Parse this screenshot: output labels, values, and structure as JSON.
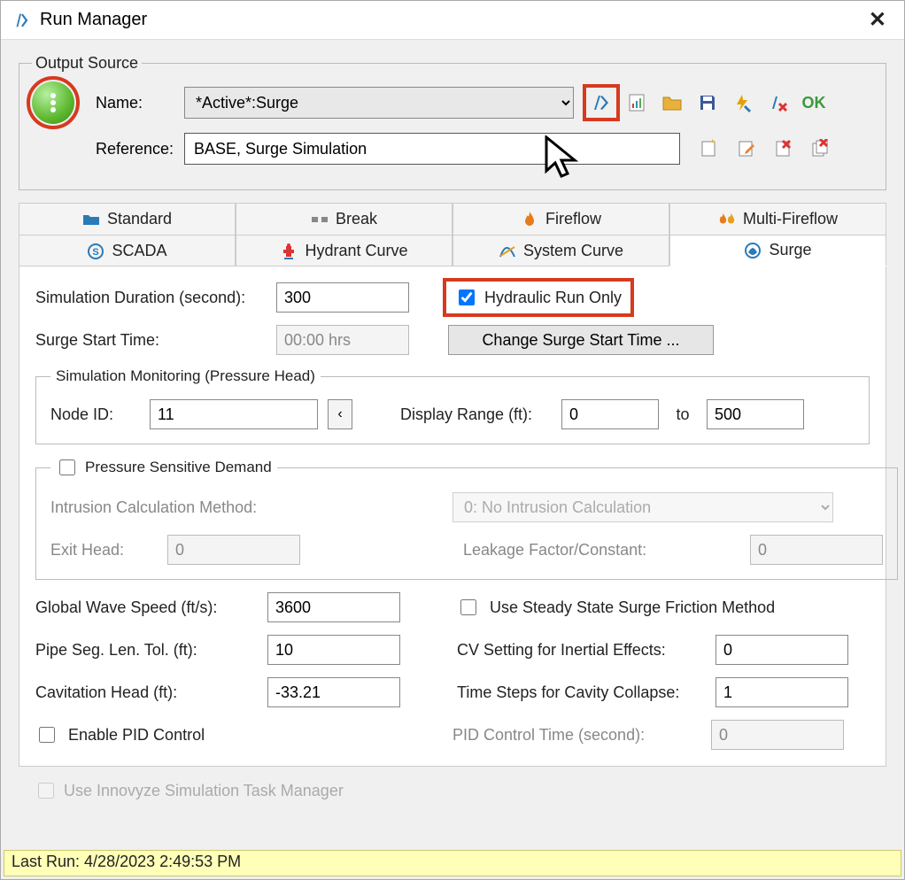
{
  "window": {
    "title": "Run Manager"
  },
  "outputSource": {
    "legend": "Output Source",
    "nameLabel": "Name:",
    "nameValue": "*Active*:Surge",
    "referenceLabel": "Reference:",
    "referenceValue": "BASE, Surge Simulation"
  },
  "okLabel": "OK",
  "tabs": {
    "standard": "Standard",
    "break": "Break",
    "fireflow": "Fireflow",
    "multiFireflow": "Multi-Fireflow",
    "scada": "SCADA",
    "hydrantCurve": "Hydrant Curve",
    "systemCurve": "System Curve",
    "surge": "Surge"
  },
  "surge": {
    "simDurationLabel": "Simulation Duration (second):",
    "simDuration": "300",
    "hydraulicRunOnly": "Hydraulic Run Only",
    "surgeStartLabel": "Surge Start Time:",
    "surgeStart": "00:00 hrs",
    "changeSurgeBtn": "Change Surge Start Time ...",
    "monitoringLegend": "Simulation Monitoring (Pressure Head)",
    "nodeIdLabel": "Node ID:",
    "nodeId": "11",
    "displayRangeLabel": "Display Range (ft):",
    "displayFrom": "0",
    "toLabel": "to",
    "displayTo": "500",
    "psdLegend": "Pressure Sensitive Demand",
    "intrusionLabel": "Intrusion Calculation Method:",
    "intrusionValue": "0: No Intrusion Calculation",
    "exitHeadLabel": "Exit Head:",
    "exitHead": "0",
    "leakageLabel": "Leakage Factor/Constant:",
    "leakage": "0",
    "globalWaveLabel": "Global Wave Speed (ft/s):",
    "globalWave": "3600",
    "useSteady": "Use Steady State Surge Friction Method",
    "pipeSegLabel": "Pipe Seg. Len. Tol. (ft):",
    "pipeSeg": "10",
    "cvSettingLabel": "CV Setting for Inertial Effects:",
    "cvSetting": "0",
    "cavHeadLabel": "Cavitation Head (ft):",
    "cavHead": "-33.21",
    "timeStepsLabel": "Time Steps for Cavity Collapse:",
    "timeSteps": "1",
    "enablePid": "Enable PID Control",
    "pidTimeLabel": "PID Control Time (second):",
    "pidTime": "0"
  },
  "footer": {
    "useInnovyze": "Use Innovyze Simulation Task Manager"
  },
  "status": {
    "lastRun": "Last Run: 4/28/2023 2:49:53 PM"
  }
}
